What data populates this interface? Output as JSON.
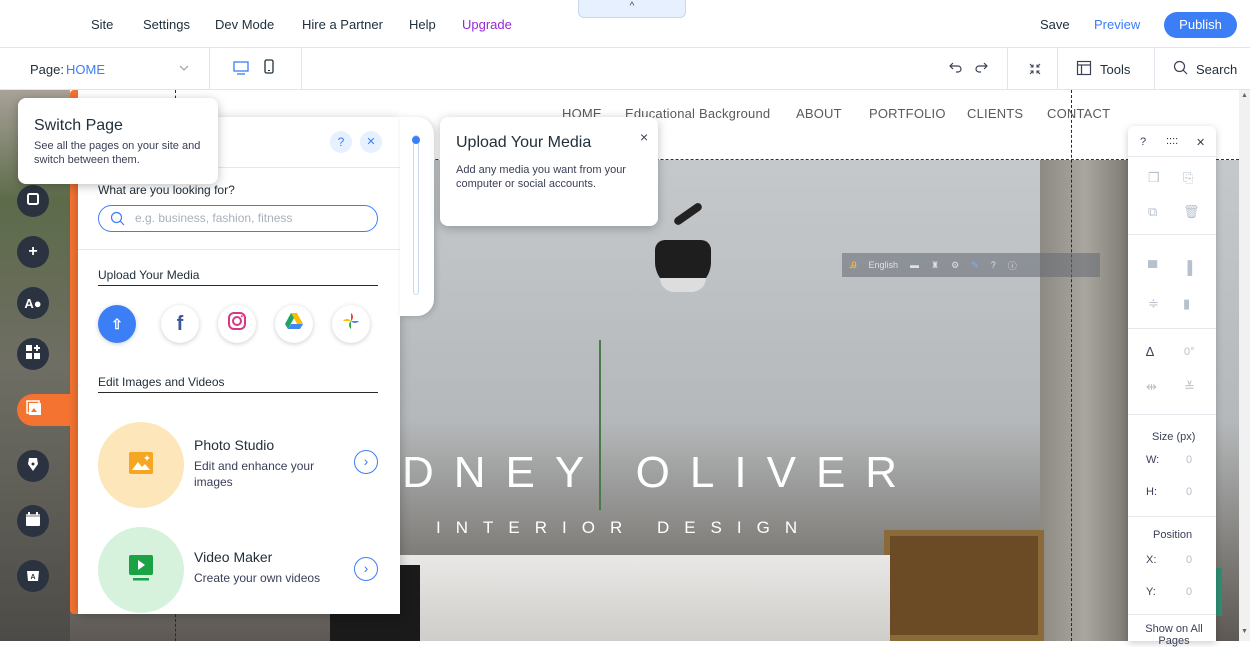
{
  "topbar": {
    "menu": [
      "Site",
      "Settings",
      "Dev Mode",
      "Hire a Partner",
      "Help",
      "Upgrade"
    ],
    "collapse_glyph": "^",
    "save": "Save",
    "preview": "Preview",
    "publish": "Publish"
  },
  "secondbar": {
    "page_prefix": "Page:",
    "page_name": "HOME",
    "tools": "Tools",
    "search": "Search"
  },
  "site": {
    "nav": [
      "HOME",
      "Educational Background",
      "ABOUT",
      "PORTFOLIO",
      "CLIENTS",
      "CONTACT"
    ],
    "hero_title": "DNEY OLIVER",
    "hero_subtitle": "INTERIOR DESIGN",
    "translate_bar": {
      "language": "English"
    }
  },
  "switch_page_tooltip": {
    "title": "Switch Page",
    "body": "See all the pages on your site and switch between them."
  },
  "media_panel": {
    "help": "?",
    "close": "✕",
    "search_label": "What are you looking for?",
    "search_placeholder": "e.g. business, fashion, fitness",
    "upload_heading": "Upload Your Media",
    "edit_heading": "Edit Images and Videos",
    "cards": [
      {
        "title": "Photo Studio",
        "subtitle": "Edit and enhance your images"
      },
      {
        "title": "Video Maker",
        "subtitle": "Create your own videos"
      }
    ]
  },
  "upload_tooltip": {
    "title": "Upload Your Media",
    "body": "Add any media you want from your computer or social accounts.",
    "close": "×"
  },
  "right_panel": {
    "help": "?",
    "drag": "::::",
    "close": "✕",
    "rotation": "0°",
    "size_heading": "Size (px)",
    "w_label": "W:",
    "w_value": "0",
    "h_label": "H:",
    "h_value": "0",
    "position_heading": "Position",
    "x_label": "X:",
    "x_value": "0",
    "y_label": "Y:",
    "y_value": "0",
    "show_all": "Show on All Pages"
  },
  "colors": {
    "accent": "#3b7ef6",
    "orange": "#f47331",
    "upgrade": "#9a27d5",
    "dark_icon": "#2c3340"
  }
}
